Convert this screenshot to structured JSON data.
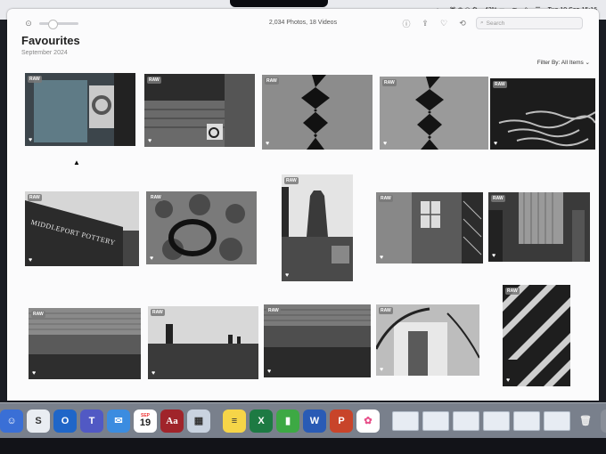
{
  "menubar": {
    "battery": "42%",
    "datetime": "Tue 19 Sep 15:16"
  },
  "toolbar": {
    "count": "2,034 Photos, 18 Videos",
    "search_placeholder": "Search"
  },
  "header": {
    "title": "Favourites",
    "subtitle": "September 2024",
    "filter": "Filter By: All Items"
  },
  "photos": [
    {
      "badge": "RAW",
      "heart": "♥",
      "subject": "window with wreath"
    },
    {
      "badge": "RAW",
      "heart": "♥",
      "subject": "brick building with bike"
    },
    {
      "badge": "RAW",
      "heart": "♥",
      "subject": "wavy reflection on water"
    },
    {
      "badge": "RAW",
      "heart": "♥",
      "subject": "wavy reflection on water"
    },
    {
      "badge": "RAW",
      "heart": "♥",
      "subject": "water ripples"
    },
    {
      "badge": "RAW",
      "heart": "♥",
      "subject": "Middleport Pottery sign"
    },
    {
      "badge": "RAW",
      "heart": "♥",
      "subject": "tyre in undergrowth"
    },
    {
      "badge": "RAW",
      "heart": "♥",
      "subject": "bottle kiln"
    },
    {
      "badge": "RAW",
      "heart": "♥",
      "subject": "old factory window"
    },
    {
      "badge": "RAW",
      "heart": "♥",
      "subject": "shed with pipes"
    },
    {
      "badge": "RAW",
      "heart": "♥",
      "subject": "corrugated building"
    },
    {
      "badge": "RAW",
      "heart": "♥",
      "subject": "rooftop chimneys"
    },
    {
      "badge": "RAW",
      "heart": "♥",
      "subject": "building reflected in water"
    },
    {
      "badge": "RAW",
      "heart": "♥",
      "subject": "tree and building"
    },
    {
      "badge": "RAW",
      "heart": "♥",
      "subject": "diagonal stripes"
    }
  ],
  "sign_text": "MIDDLEPORT POTTERY",
  "dock": {
    "calendar_month": "SEP",
    "calendar_day": "19",
    "dictionary_label": "Aa"
  },
  "colors": {
    "accent": "#2f6fe0",
    "dock_bg": "#c8d2e1"
  }
}
